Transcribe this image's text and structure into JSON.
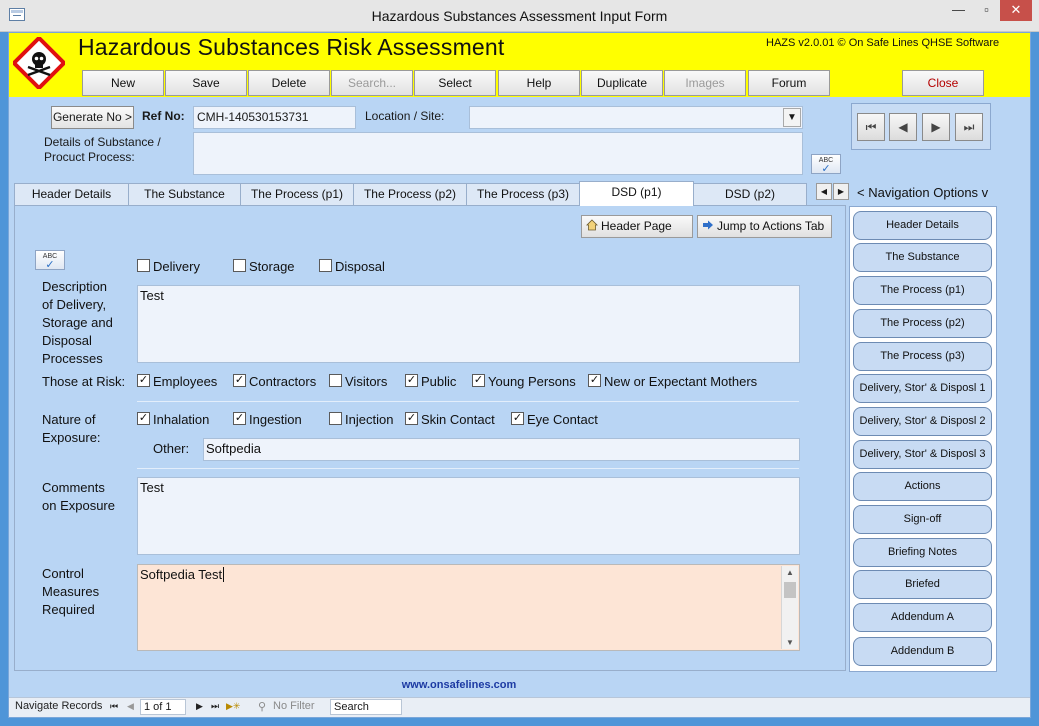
{
  "window": {
    "title": "Hazardous Substances Assessment Input Form",
    "min_glyph": "—",
    "max_glyph": "▫",
    "close_glyph": "✕"
  },
  "header": {
    "title": "Hazardous Substances Risk Assessment",
    "version": "HAZS v2.0.01 © On Safe Lines QHSE Software",
    "bg_color": "#ffff00"
  },
  "toolbar": {
    "new": "New",
    "save": "Save",
    "delete": "Delete",
    "search": "Search...",
    "select": "Select",
    "help": "Help",
    "duplicate": "Duplicate",
    "images": "Images",
    "forum": "Forum",
    "close": "Close"
  },
  "record": {
    "generate_label": "Generate No >",
    "ref_label": "Ref No:",
    "ref_value": "CMH-140530153731",
    "location_label": "Location / Site:",
    "location_value": "",
    "details_label_line1": "Details of Substance /",
    "details_label_line2": "Procuct Process:",
    "details_value": ""
  },
  "record_nav": {
    "first": "⏮",
    "prev": "◀",
    "next": "▶",
    "last": "⏭"
  },
  "spell_label": "ABC",
  "tabs": [
    {
      "label": "Header Details"
    },
    {
      "label": "The Substance"
    },
    {
      "label": "The Process (p1)"
    },
    {
      "label": "The Process (p2)"
    },
    {
      "label": "The Process (p3)"
    },
    {
      "label": "DSD (p1)"
    },
    {
      "label": "DSD (p2)"
    }
  ],
  "tab_scroll": {
    "left": "◀",
    "right": "▶"
  },
  "navigation_options_label": "< Navigation Options v",
  "page": {
    "header_page_btn": "Header Page",
    "jump_actions_btn": "Jump to Actions Tab",
    "dsd_options": [
      {
        "label": "Delivery",
        "checked": false
      },
      {
        "label": "Storage",
        "checked": false
      },
      {
        "label": "Disposal",
        "checked": false
      }
    ],
    "description_label": [
      "Description",
      "of Delivery,",
      "Storage and",
      "Disposal",
      "Processes"
    ],
    "description_value": "Test",
    "at_risk_label": "Those at Risk:",
    "at_risk": [
      {
        "label": "Employees",
        "checked": true
      },
      {
        "label": "Contractors",
        "checked": true
      },
      {
        "label": "Visitors",
        "checked": false
      },
      {
        "label": "Public",
        "checked": true
      },
      {
        "label": "Young Persons",
        "checked": true
      },
      {
        "label": "New or Expectant Mothers",
        "checked": true
      }
    ],
    "exposure_label": [
      "Nature of",
      "Exposure:"
    ],
    "exposure": [
      {
        "label": "Inhalation",
        "checked": true
      },
      {
        "label": "Ingestion",
        "checked": true
      },
      {
        "label": "Injection",
        "checked": false
      },
      {
        "label": "Skin Contact",
        "checked": true
      },
      {
        "label": "Eye Contact",
        "checked": true
      }
    ],
    "other_label": "Other:",
    "other_value": "Softpedia",
    "comments_label": [
      "Comments",
      "on Exposure"
    ],
    "comments_value": "Test",
    "control_label": [
      "Control",
      "Measures",
      "Required"
    ],
    "control_value": "Softpedia Test",
    "check_glyph": "✓"
  },
  "nav_panel": [
    "Header Details",
    "The Substance",
    "The Process (p1)",
    "The Process (p2)",
    "The Process (p3)",
    "Delivery, Stor' & Disposl 1",
    "Delivery, Stor' & Disposl 2",
    "Delivery, Stor' & Disposl 3",
    "Actions",
    "Sign-off",
    "Briefing Notes",
    "Briefed",
    "Addendum A",
    "Addendum B"
  ],
  "footer": {
    "url": "www.onsafelines.com",
    "navigate_label": "Navigate Records",
    "record_counter": "1 of 1",
    "no_filter": "No Filter",
    "search": "Search",
    "nav_first": "⏮",
    "nav_prev": "◀",
    "nav_next": "▶",
    "nav_last": "⏭",
    "nav_new": "▶✳"
  }
}
